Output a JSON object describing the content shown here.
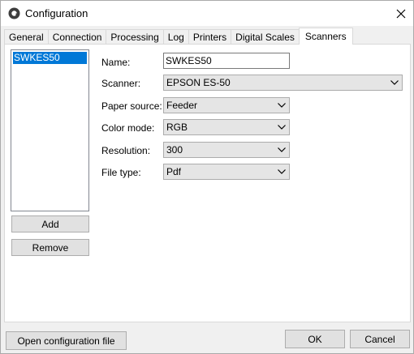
{
  "window": {
    "title": "Configuration"
  },
  "tabs": [
    {
      "label": "General"
    },
    {
      "label": "Connection"
    },
    {
      "label": "Processing"
    },
    {
      "label": "Log"
    },
    {
      "label": "Printers"
    },
    {
      "label": "Digital Scales"
    },
    {
      "label": "Scanners",
      "active": true
    }
  ],
  "scanners": {
    "list": [
      "SWKES50"
    ],
    "selected": "SWKES50",
    "add_label": "Add",
    "remove_label": "Remove"
  },
  "form": {
    "name_label": "Name:",
    "name_value": "SWKES50",
    "scanner_label": "Scanner:",
    "scanner_value": "EPSON ES-50",
    "paper_source_label": "Paper source:",
    "paper_source_value": "Feeder",
    "color_mode_label": "Color mode:",
    "color_mode_value": "RGB",
    "resolution_label": "Resolution:",
    "resolution_value": "300",
    "file_type_label": "File type:",
    "file_type_value": "Pdf"
  },
  "footer": {
    "open_config_label": "Open configuration file",
    "ok_label": "OK",
    "cancel_label": "Cancel"
  },
  "colors": {
    "selection": "#0078d7",
    "window_bg": "#f0f0f0",
    "panel_bg": "#ffffff"
  },
  "icons": {
    "app": "app-logo-icon",
    "close": "close-icon",
    "dropdown": "chevron-down-icon"
  }
}
